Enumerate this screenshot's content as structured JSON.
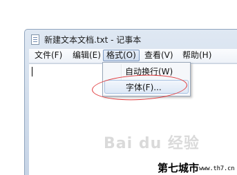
{
  "window": {
    "title": "新建文本文档.txt - 记事本"
  },
  "menubar": {
    "items": [
      {
        "label": "文件(F)"
      },
      {
        "label": "编辑(E)"
      },
      {
        "label": "格式(O)"
      },
      {
        "label": "查看(V)"
      },
      {
        "label": "帮助(H)"
      }
    ],
    "open_menu": "格式(O)"
  },
  "format_menu": {
    "items": [
      {
        "label": "自动换行(W)"
      },
      {
        "label": "字体(F)..."
      }
    ],
    "highlighted": "字体(F)..."
  },
  "annotation": {
    "color": "#e0383a"
  },
  "watermark": {
    "text": "Bai du 经验"
  },
  "logo": {
    "name": "第七城市",
    "url": "www.th7.cn"
  }
}
